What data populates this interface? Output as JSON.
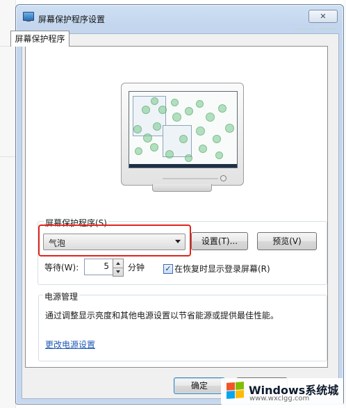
{
  "window": {
    "title": "屏幕保护程序设置",
    "close_symbol": "✕"
  },
  "tab": {
    "label": "屏幕保护程序"
  },
  "screensaver": {
    "group_label": "屏幕保护程序(S)",
    "selected": "气泡",
    "settings_label": "设置(T)...",
    "preview_label": "预览(V)"
  },
  "wait": {
    "label": "等待(W):",
    "value": "5",
    "unit": "分钟",
    "resume_checked": true,
    "check_mark": "✓",
    "resume_label": "在恢复时显示登录屏幕(R)"
  },
  "power": {
    "group_label": "电源管理",
    "description": "通过调整显示亮度和其他电源设置以节省能源或提供最佳性能。",
    "link": "更改电源设置"
  },
  "footer": {
    "ok_label": "确定",
    "cancel_label": ""
  },
  "watermark": {
    "title": "Windows系统城",
    "url": "www.wxclgg.com",
    "logo_colors": [
      "#f35325",
      "#81bc06",
      "#05a6f0",
      "#ffba08"
    ]
  },
  "colors": {
    "highlight": "#e0241b",
    "link": "#1f59b4",
    "titlebar": "#c3d6ee"
  },
  "icons": [
    "monitor-icon",
    "close-icon",
    "dropdown-caret-icon",
    "spinner-up-icon",
    "spinner-down-icon",
    "checkmark-icon",
    "windows-logo-icon"
  ]
}
